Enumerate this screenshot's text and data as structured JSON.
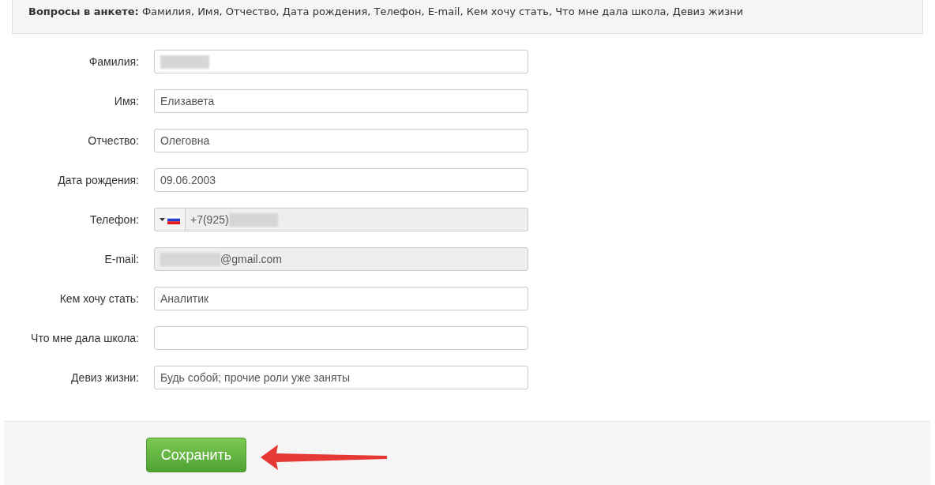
{
  "questions_box": {
    "heading": "Вопросы в анкете:",
    "text": "Фамилия, Имя, Отчество, Дата рождения, Телефон, E-mail, Кем хочу стать, Что мне дала школа, Девиз жизни"
  },
  "fields": [
    {
      "kind": "text",
      "label": "Фамилия:",
      "redacted": true,
      "disabled": false
    },
    {
      "kind": "text",
      "label": "Имя:",
      "value_before": "Елизавета",
      "disabled": false
    },
    {
      "kind": "text",
      "label": "Отчество:",
      "value_before": "Олеговна",
      "disabled": false
    },
    {
      "kind": "text",
      "label": "Дата рождения:",
      "value_before": "09.06.2003",
      "disabled": false
    },
    {
      "kind": "phone",
      "label": "Телефон:",
      "value_before": "+7(925)",
      "redacted": true,
      "disabled": true
    },
    {
      "kind": "text",
      "label": "E-mail:",
      "redacted": true,
      "value_after": "@gmail.com",
      "disabled": true
    },
    {
      "kind": "text",
      "label": "Кем хочу стать:",
      "value_before": "Аналитик",
      "disabled": false
    },
    {
      "kind": "text",
      "label": "Что мне дала школа:",
      "disabled": false
    },
    {
      "kind": "text",
      "label": "Девиз жизни:",
      "value_before": "Будь собой; прочие роли уже заняты",
      "disabled": false
    }
  ],
  "save_button": "Сохранить"
}
